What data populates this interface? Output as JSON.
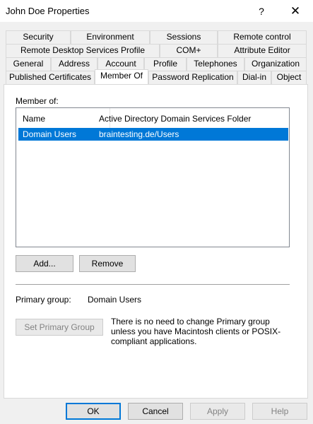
{
  "window": {
    "title": "John Doe Properties",
    "help_glyph": "?",
    "close_glyph": "✕"
  },
  "tabs": {
    "row1": [
      "Security",
      "Environment",
      "Sessions",
      "Remote control"
    ],
    "row2": [
      "Remote Desktop Services Profile",
      "COM+",
      "Attribute Editor"
    ],
    "row3": [
      "General",
      "Address",
      "Account",
      "Profile",
      "Telephones",
      "Organization"
    ],
    "row4": [
      "Published Certificates",
      "Member Of",
      "Password Replication",
      "Dial-in",
      "Object"
    ],
    "active": "Member Of"
  },
  "member_of": {
    "label": "Member of:",
    "columns": [
      "Name",
      "Active Directory Domain Services Folder"
    ],
    "rows": [
      {
        "name": "Domain Users",
        "folder": "braintesting.de/Users",
        "selected": true
      }
    ]
  },
  "buttons": {
    "add": "Add...",
    "remove": "Remove",
    "set_primary": "Set Primary Group"
  },
  "primary_group": {
    "label": "Primary group:",
    "value": "Domain Users",
    "note": "There is no need to change Primary group unless you have Macintosh clients or POSIX-compliant applications."
  },
  "footer": {
    "ok": "OK",
    "cancel": "Cancel",
    "apply": "Apply",
    "help": "Help"
  },
  "colors": {
    "selection": "#0078d7",
    "focus_border": "#0078d7"
  }
}
